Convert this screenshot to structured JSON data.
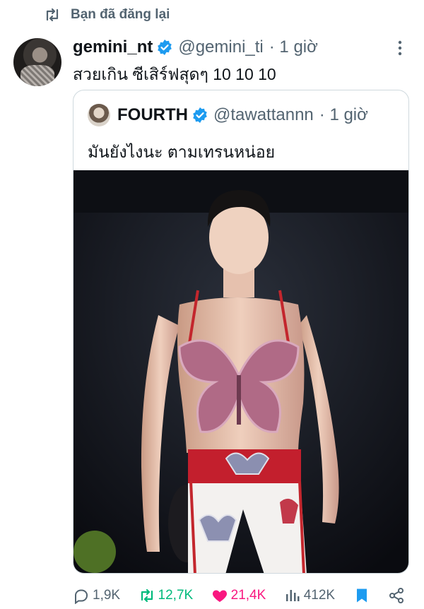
{
  "repost_banner": {
    "label": "Bạn đã đăng lại",
    "icon": "repost-icon"
  },
  "tweet": {
    "name": "gemini_nt",
    "handle": "@gemini_ti",
    "time": "· 1 giờ",
    "text": "สวยเกิน ซีเสิร์ฟสุดๆ 10 10 10",
    "verified_color": "#1d9bf0"
  },
  "quoted_tweet": {
    "name": "FOURTH",
    "handle": "@tawattannn",
    "time": "· 1 giờ",
    "text": "มันยังไงนะ ตามเทรนหน่อย"
  },
  "actions": {
    "replies": "1,9K",
    "reposts": "12,7K",
    "likes": "21,4K",
    "views": "412K"
  },
  "colors": {
    "repost_active": "#00ba7c",
    "like_active": "#f91880",
    "bookmark_active": "#1d9bf0",
    "muted": "#536471"
  }
}
